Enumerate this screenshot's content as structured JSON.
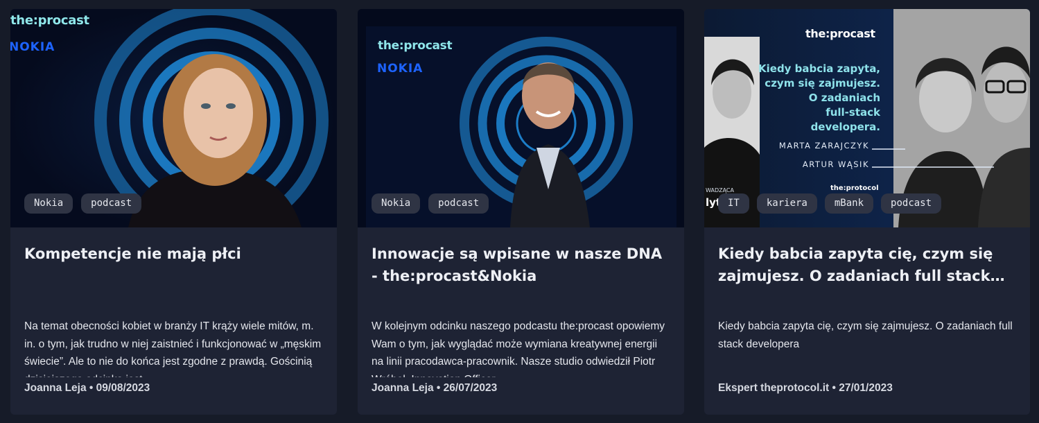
{
  "cards": [
    {
      "thumb": {
        "brand": "the:procast",
        "partner": "NOKIA"
      },
      "tags": [
        "Nokia",
        "podcast"
      ],
      "title": "Kompetencje nie mają płci",
      "description": "Na temat obecności kobiet w branży IT krąży wiele mitów, m. in. o tym, jak trudno w niej zaistnieć i funkcjonować w „męskim świecie”. Ale to nie do końca jest zgodne z prawdą. Gościnią dzisiejszego odcinka jest",
      "author": "Joanna Leja",
      "date": "09/08/2023"
    },
    {
      "thumb": {
        "brand": "the:procast",
        "partner": "NOKIA"
      },
      "tags": [
        "Nokia",
        "podcast"
      ],
      "title": "Innowacje są wpisane w nasze DNA - the:procast&Nokia",
      "description": "W kolejnym odcinku naszego podcastu the:procast opowiemy Wam o tym, jak wyglądać może wymiana kreatywnej energii na linii pracodawca-pracownik. Nasze studio odwiedził Piotr Wróbel, Innovation Officer",
      "author": "Joanna Leja",
      "date": "26/07/2023"
    },
    {
      "thumb": {
        "brand": "the:procast",
        "headline": [
          "Kiedy babcia zapyta,",
          "czym się zajmujesz.",
          "O zadaniach",
          "full-stack developera."
        ],
        "names": [
          "MARTA ZARAJCZYK",
          "ARTUR WĄSIK"
        ],
        "footer_brand": "the:protocol",
        "side_label": "WADZĄCA",
        "side_name": "lyta"
      },
      "tags": [
        "IT",
        "kariera",
        "mBank",
        "podcast"
      ],
      "title": "Kiedy babcia zapyta cię, czym się zajmujesz. O zadaniach full stack developera",
      "description": "Kiedy babcia zapyta cię, czym się zajmujesz. O zadaniach full stack developera",
      "author": "Ekspert theprotocol.it",
      "date": "27/01/2023"
    }
  ],
  "separator": "•",
  "colors": {
    "background": "#161b28",
    "card": "#1e2334",
    "tag": "#2f3444",
    "brand": "#8fe6ea",
    "nokia": "#1d63ff",
    "ring": "#1f8ad8"
  }
}
